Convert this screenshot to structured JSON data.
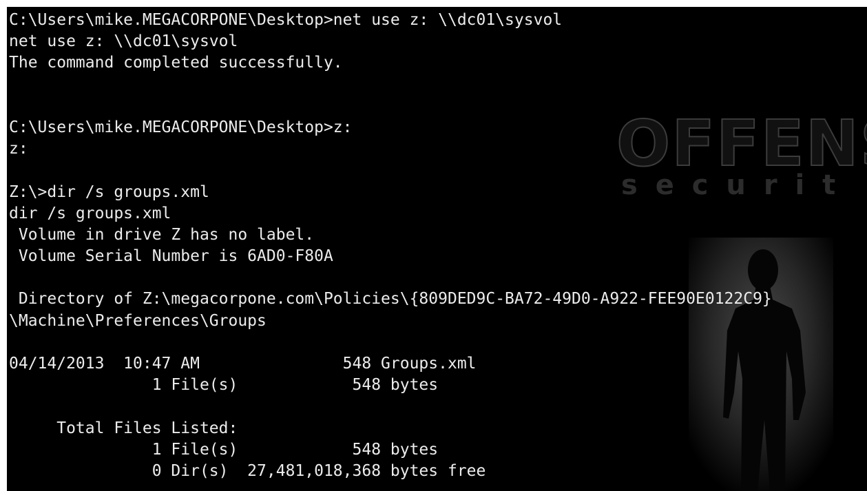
{
  "window": {
    "background": "#000000",
    "text_color": "#ececec"
  },
  "wallpaper": {
    "logo_word_top": "OFFENSIV",
    "logo_word_bottom": "s e c u r i t",
    "figure_icon": "silhouette-person-icon",
    "accent_color": "#3a3a3a"
  },
  "terminal": {
    "lines": [
      "C:\\Users\\mike.MEGACORPONE\\Desktop>net use z: \\\\dc01\\sysvol",
      "net use z: \\\\dc01\\sysvol",
      "The command completed successfully.",
      "",
      "",
      "C:\\Users\\mike.MEGACORPONE\\Desktop>z:",
      "z:",
      "",
      "Z:\\>dir /s groups.xml",
      "dir /s groups.xml",
      " Volume in drive Z has no label.",
      " Volume Serial Number is 6AD0-F80A",
      "",
      " Directory of Z:\\megacorpone.com\\Policies\\{809DED9C-BA72-49D0-A922-FEE90E0122C9}",
      "\\Machine\\Preferences\\Groups",
      "",
      "04/14/2013  10:47 AM               548 Groups.xml",
      "               1 File(s)            548 bytes",
      "",
      "     Total Files Listed:",
      "               1 File(s)            548 bytes",
      "               0 Dir(s)  27,481,018,368 bytes free"
    ]
  }
}
